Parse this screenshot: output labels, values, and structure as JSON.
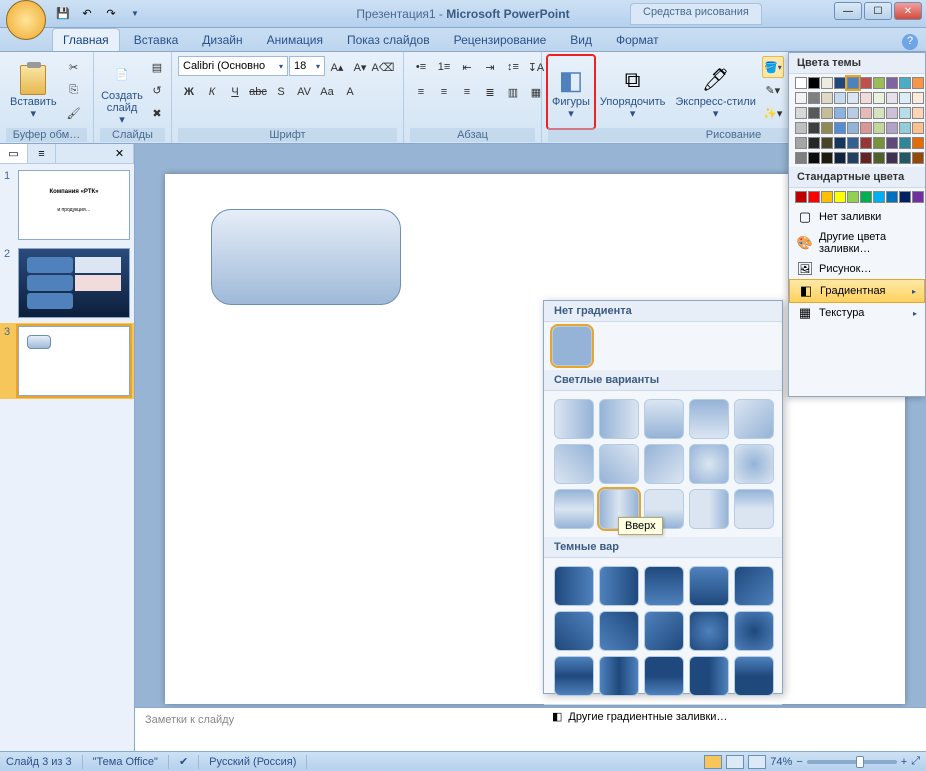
{
  "title": {
    "doc": "Презентация1",
    "app": "Microsoft PowerPoint"
  },
  "tool_context_tab": "Средства рисования",
  "qat": {
    "save": "💾",
    "undo": "↶",
    "redo": "↷"
  },
  "window_buttons": {
    "min": "—",
    "max": "☐",
    "close": "✕"
  },
  "help_icon": "?",
  "tabs": [
    "Главная",
    "Вставка",
    "Дизайн",
    "Анимация",
    "Показ слайдов",
    "Рецензирование",
    "Вид",
    "Формат"
  ],
  "active_tab": "Главная",
  "ribbon": {
    "clipboard": {
      "label": "Буфер обм…",
      "paste": "Вставить",
      "cut_icon": "✂",
      "copy_icon": "⎘",
      "brush_icon": "🖌"
    },
    "slides": {
      "label": "Слайды",
      "new_slide": "Создать\nслайд"
    },
    "font": {
      "label": "Шрифт",
      "family": "Calibri (Основно",
      "size": "18",
      "row1": [
        "Ж",
        "К",
        "Ч",
        "abc",
        "S",
        "AV",
        "Aa",
        "A"
      ]
    },
    "paragraph": {
      "label": "Абзац"
    },
    "drawing": {
      "label": "Рисование",
      "shapes": "Фигуры",
      "arrange": "Упорядочить",
      "quick": "Экспресс-стили"
    },
    "fill_button_icon": "▾"
  },
  "fill_panel": {
    "theme_head": "Цвета темы",
    "std_head": "Стандартные цвета",
    "theme_colors": [
      "#ffffff",
      "#000000",
      "#eeece1",
      "#1f497d",
      "#4f81bd",
      "#c0504d",
      "#9bbb59",
      "#8064a2",
      "#4bacc6",
      "#f79646"
    ],
    "theme_tints": [
      [
        "#f2f2f2",
        "#7f7f7f",
        "#ddd9c3",
        "#c6d9f0",
        "#dbe5f1",
        "#f2dcdb",
        "#ebf1dd",
        "#e5e0ec",
        "#dbeef3",
        "#fdeada"
      ],
      [
        "#d8d8d8",
        "#595959",
        "#c4bd97",
        "#8db3e2",
        "#b8cce4",
        "#e5b9b7",
        "#d7e3bc",
        "#ccc1d9",
        "#b7dde8",
        "#fbd5b5"
      ],
      [
        "#bfbfbf",
        "#3f3f3f",
        "#938953",
        "#548dd4",
        "#95b3d7",
        "#d99694",
        "#c3d69b",
        "#b2a2c7",
        "#92cddc",
        "#fac08f"
      ],
      [
        "#a5a5a5",
        "#262626",
        "#494429",
        "#17365d",
        "#366092",
        "#953734",
        "#76923c",
        "#5f497a",
        "#31859b",
        "#e36c09"
      ],
      [
        "#7f7f7f",
        "#0c0c0c",
        "#1d1b10",
        "#0f243e",
        "#244061",
        "#632423",
        "#4f6128",
        "#3f3151",
        "#205867",
        "#974806"
      ]
    ],
    "std_colors": [
      "#c00000",
      "#ff0000",
      "#ffc000",
      "#ffff00",
      "#92d050",
      "#00b050",
      "#00b0f0",
      "#0070c0",
      "#002060",
      "#7030a0"
    ],
    "no_fill": "Нет заливки",
    "more_colors": "Другие цвета заливки…",
    "picture": "Рисунок…",
    "gradient": "Градиентная",
    "texture": "Текстура"
  },
  "grad_popup": {
    "no_grad_head": "Нет градиента",
    "light_head": "Светлые варианты",
    "dark_head": "Темные варианты",
    "more": "Другие градиентные заливки…",
    "tooltip": "Вверх",
    "dark_head_clipped": "Темные вар"
  },
  "outline": {
    "slides": [
      1,
      2,
      3
    ],
    "selected": 3,
    "t1_text1": "Компания «РТК»",
    "t1_text2": "и продукция…"
  },
  "notes_placeholder": "Заметки к слайду",
  "status": {
    "slide_of": "Слайд 3 из 3",
    "theme": "\"Тема Office\"",
    "lang": "Русский (Россия)",
    "zoom": "74%",
    "zoom_minus": "−",
    "zoom_plus": "+",
    "fit_icon": "⤢"
  }
}
